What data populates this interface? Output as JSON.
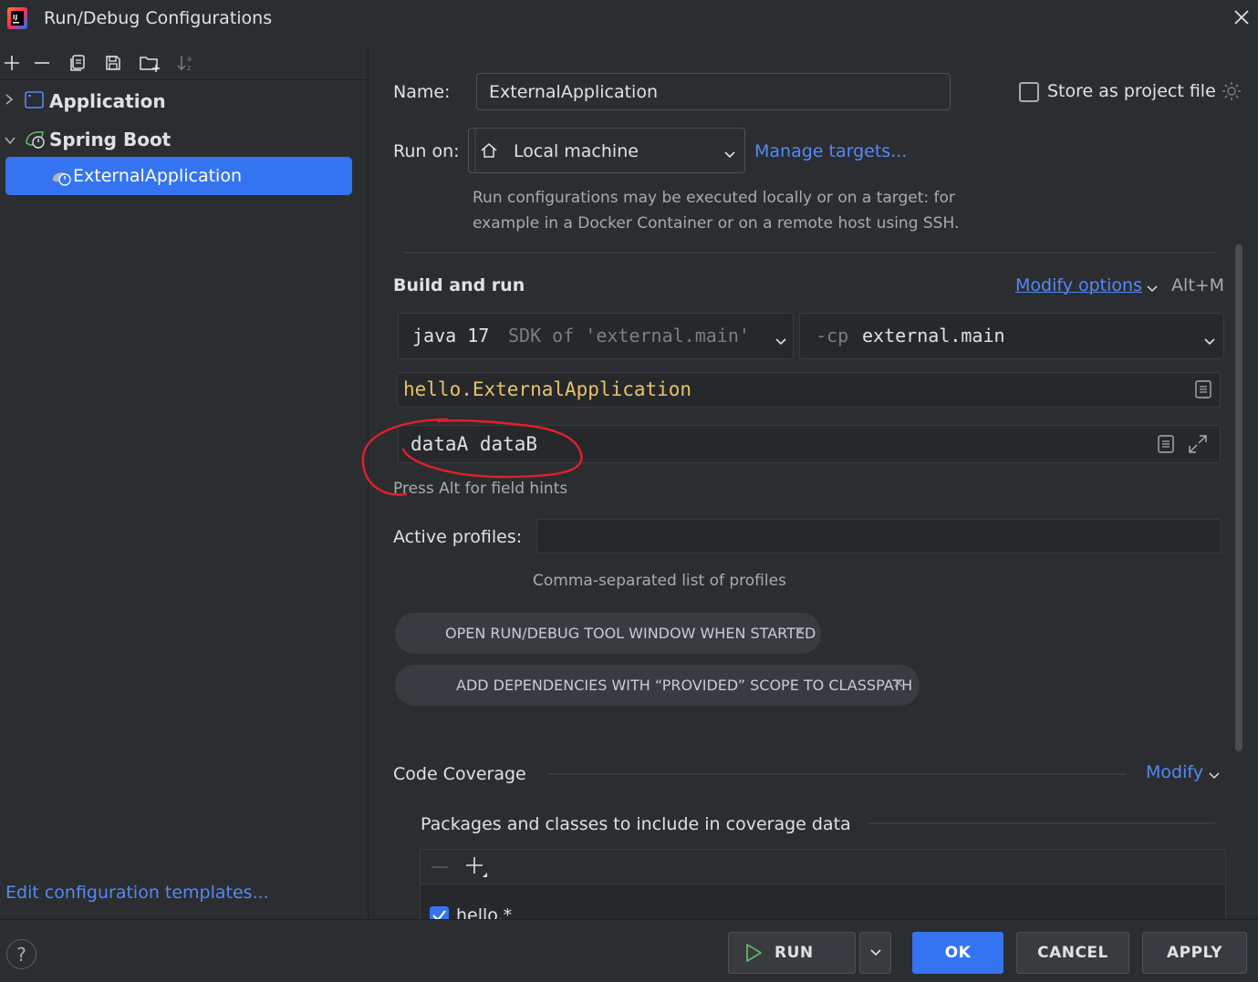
{
  "window": {
    "title": "Run/Debug Configurations"
  },
  "left_panel": {
    "tree": [
      {
        "label": "Application",
        "expanded": false,
        "icon": "application-icon"
      },
      {
        "label": "Spring Boot",
        "expanded": true,
        "icon": "spring-boot-icon"
      },
      {
        "label": "ExternalApplication",
        "selected": true,
        "icon": "spring-boot-run-icon"
      }
    ],
    "edit_templates_link": "Edit configuration templates..."
  },
  "form": {
    "name_label": "Name:",
    "name_value": "ExternalApplication",
    "store_as_project_file": "Store as project file",
    "store_checked": false,
    "run_on_label": "Run on:",
    "run_on_value": "Local machine",
    "manage_targets": "Manage targets...",
    "run_on_hint_1": "Run configurations may be executed locally or on a target: for",
    "run_on_hint_2": "example in a Docker Container or on a remote host using SSH.",
    "build_and_run": "Build and run",
    "modify_options": "Modify options",
    "modify_shortcut": "Alt+M",
    "jdk_prefix": "java 17",
    "jdk_suffix": "SDK of 'external.main'",
    "cp_prefix": "-cp",
    "cp_value": "external.main",
    "main_class": "hello.ExternalApplication",
    "program_args": "dataA dataB",
    "field_hints": "Press Alt for field hints",
    "active_profiles_label": "Active profiles:",
    "active_profiles_value": "",
    "profiles_hint": "Comma-separated list of profiles",
    "chips": [
      "OPEN RUN/DEBUG TOOL WINDOW WHEN STARTED",
      "ADD DEPENDENCIES WITH “PROVIDED” SCOPE TO CLASSPATH"
    ],
    "code_coverage": "Code Coverage",
    "modify": "Modify",
    "packages_title": "Packages and classes to include in coverage data",
    "packages": [
      {
        "label": "hello.*",
        "checked": true
      }
    ]
  },
  "footer": {
    "help": "?",
    "run": "RUN",
    "ok": "OK",
    "cancel": "CANCEL",
    "apply": "APPLY"
  },
  "colors": {
    "accent": "#3574f0",
    "link": "#548af7",
    "background": "#2b2d30",
    "annotation": "#e0202a",
    "run_icon": "#5fb865"
  }
}
